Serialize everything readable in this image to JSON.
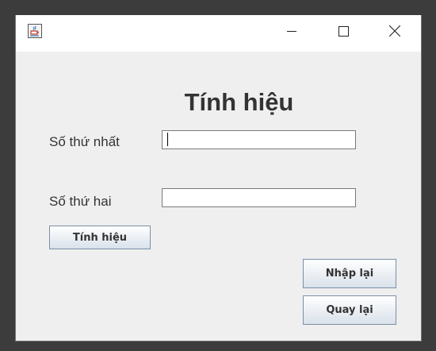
{
  "window": {
    "title": "",
    "icons": {
      "app": "java-cup-icon",
      "minimize": "minimize-icon",
      "maximize": "maximize-icon",
      "close": "close-icon"
    }
  },
  "form": {
    "heading": "Tính hiệu",
    "first_label": "Số thứ nhất",
    "first_value": "",
    "second_label": "Số thứ hai",
    "second_value": "",
    "compute_button": "Tính hiệu",
    "reset_button": "Nhập lại",
    "back_button": "Quay lại"
  }
}
